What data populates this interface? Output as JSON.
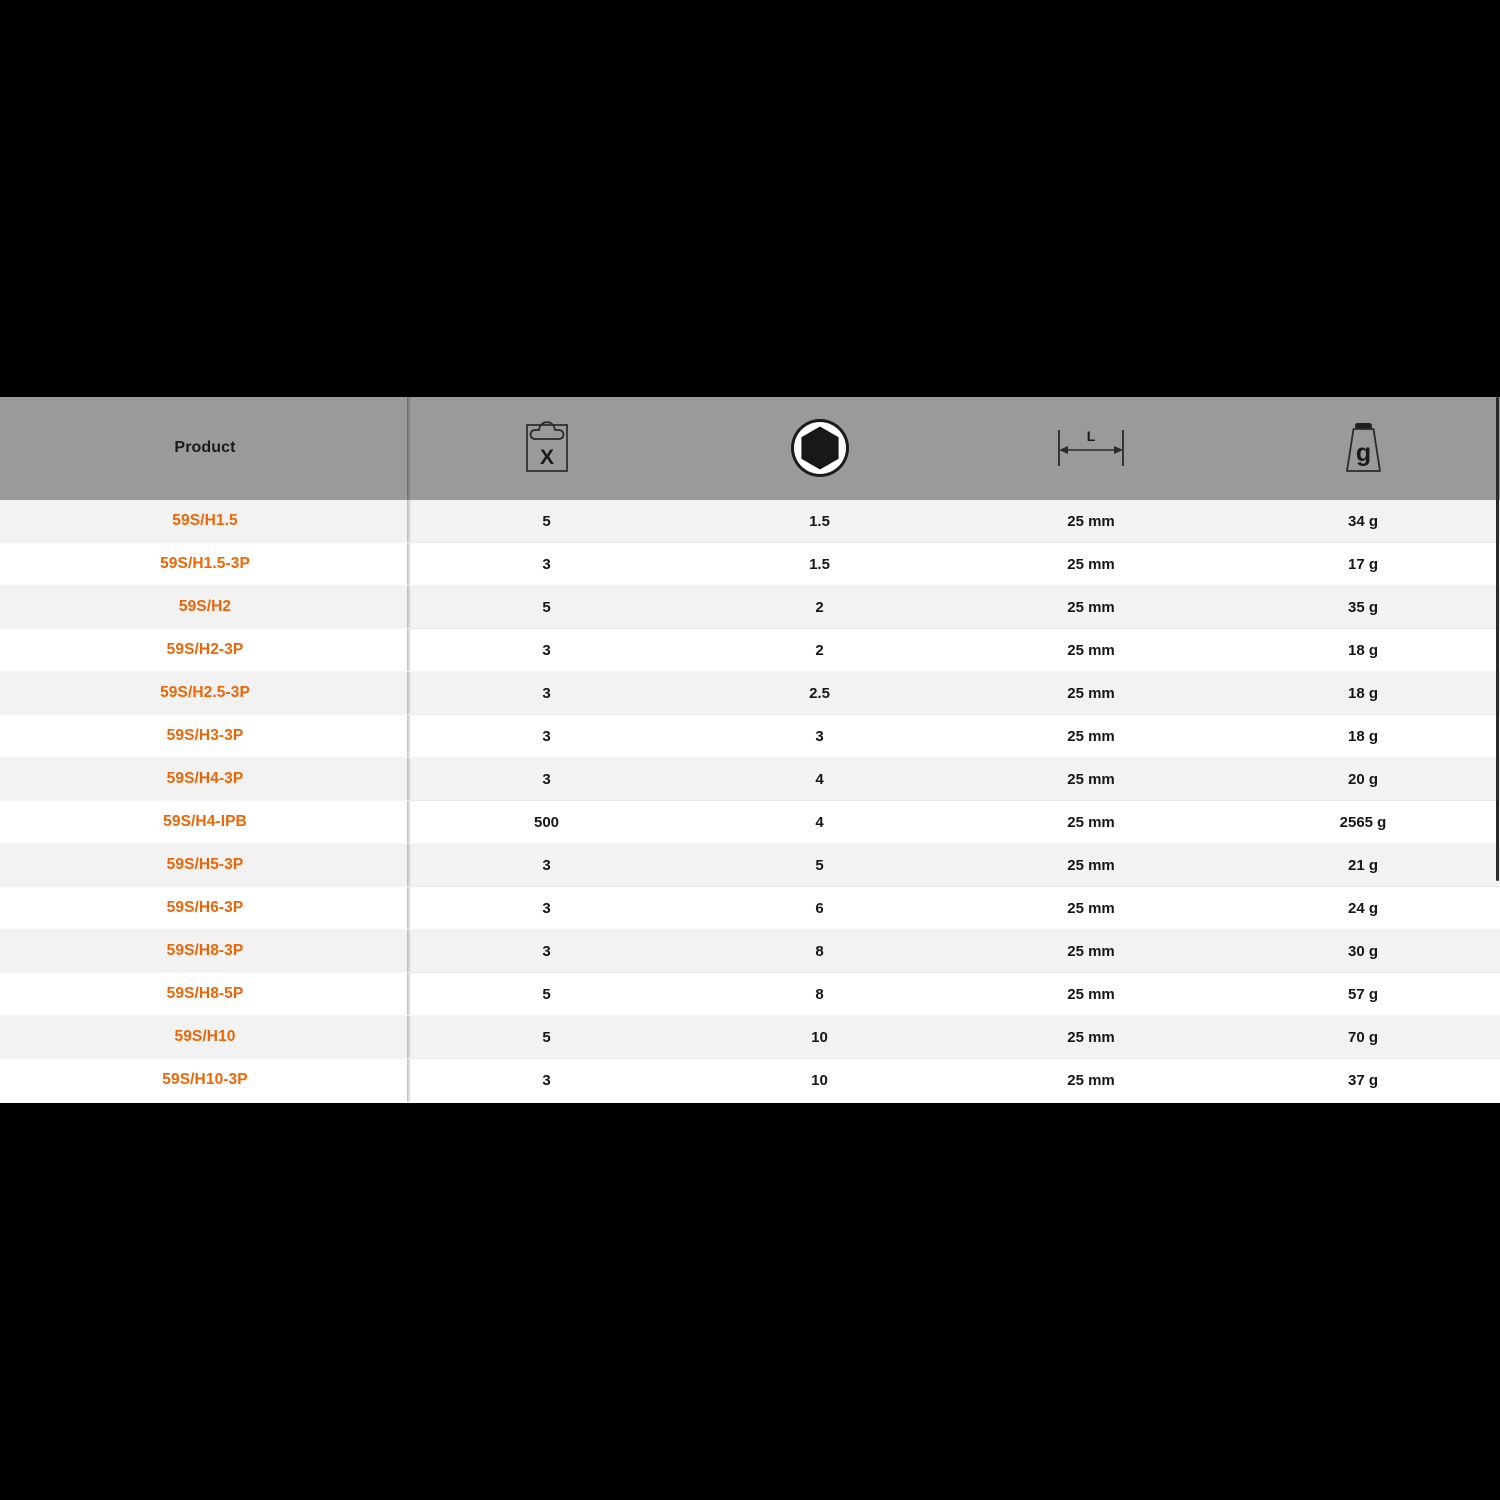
{
  "table": {
    "columns": [
      {
        "key": "product",
        "label": "Product",
        "icon": null
      },
      {
        "key": "pack",
        "label": "",
        "icon": "blister-pack-quantity-icon"
      },
      {
        "key": "hex",
        "label": "",
        "icon": "hex-socket-size-icon"
      },
      {
        "key": "length",
        "label": "",
        "icon": "length-dimension-icon"
      },
      {
        "key": "weight",
        "label": "",
        "icon": "weight-gram-icon"
      }
    ],
    "icon_labels": {
      "pack": "X",
      "length": "L",
      "weight": "g"
    },
    "rows": [
      {
        "product": "59S/H1.5",
        "pack": "5",
        "hex": "1.5",
        "length": "25 mm",
        "weight": "34 g"
      },
      {
        "product": "59S/H1.5-3P",
        "pack": "3",
        "hex": "1.5",
        "length": "25 mm",
        "weight": "17 g"
      },
      {
        "product": "59S/H2",
        "pack": "5",
        "hex": "2",
        "length": "25 mm",
        "weight": "35 g"
      },
      {
        "product": "59S/H2-3P",
        "pack": "3",
        "hex": "2",
        "length": "25 mm",
        "weight": "18 g"
      },
      {
        "product": "59S/H2.5-3P",
        "pack": "3",
        "hex": "2.5",
        "length": "25 mm",
        "weight": "18 g"
      },
      {
        "product": "59S/H3-3P",
        "pack": "3",
        "hex": "3",
        "length": "25 mm",
        "weight": "18 g"
      },
      {
        "product": "59S/H4-3P",
        "pack": "3",
        "hex": "4",
        "length": "25 mm",
        "weight": "20 g"
      },
      {
        "product": "59S/H4-IPB",
        "pack": "500",
        "hex": "4",
        "length": "25 mm",
        "weight": "2565 g"
      },
      {
        "product": "59S/H5-3P",
        "pack": "3",
        "hex": "5",
        "length": "25 mm",
        "weight": "21 g"
      },
      {
        "product": "59S/H6-3P",
        "pack": "3",
        "hex": "6",
        "length": "25 mm",
        "weight": "24 g"
      },
      {
        "product": "59S/H8-3P",
        "pack": "3",
        "hex": "8",
        "length": "25 mm",
        "weight": "30 g"
      },
      {
        "product": "59S/H8-5P",
        "pack": "5",
        "hex": "8",
        "length": "25 mm",
        "weight": "57 g"
      },
      {
        "product": "59S/H10",
        "pack": "5",
        "hex": "10",
        "length": "25 mm",
        "weight": "70 g"
      },
      {
        "product": "59S/H10-3P",
        "pack": "3",
        "hex": "10",
        "length": "25 mm",
        "weight": "37 g"
      }
    ]
  },
  "colors": {
    "accent_orange": "#ec6608",
    "header_gray": "#9a9a9a",
    "row_alt": "#f2f2f2",
    "row_base": "#ffffff",
    "text_dark": "#17171a",
    "letterbox": "#000000"
  }
}
